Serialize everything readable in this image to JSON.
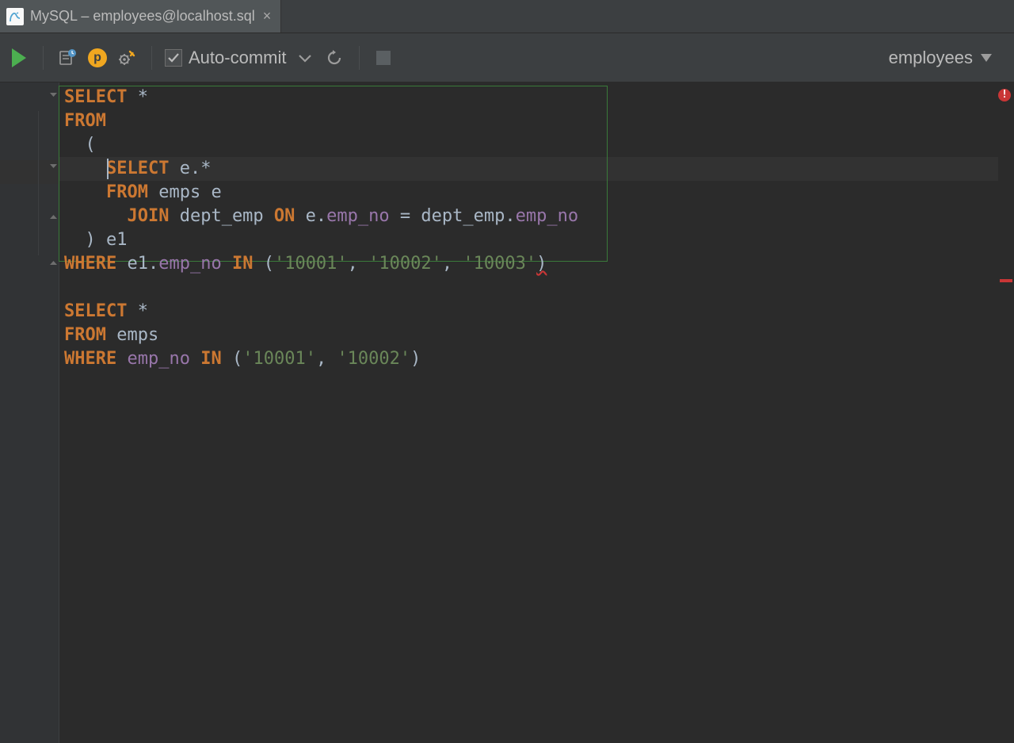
{
  "tab": {
    "title": "MySQL – employees@localhost.sql",
    "close_glyph": "×"
  },
  "toolbar": {
    "p_badge": "p",
    "autocommit_label": "Auto-commit",
    "schema_label": "employees"
  },
  "code": {
    "l1_select": "SELECT",
    "l1_star": " *",
    "l2_from": "FROM",
    "l3_lparen": "  (",
    "l4_indent": "    ",
    "l4_select": "SELECT",
    "l4_after": " e.",
    "l4_star": "*",
    "l5_indent": "    ",
    "l5_from": "FROM",
    "l5_after": " emps e",
    "l6_indent": "      ",
    "l6_join": "JOIN",
    "l6_a": " dept_emp ",
    "l6_on": "ON",
    "l6_b": " e.",
    "l6_emp1": "emp_no",
    "l6_c": " = dept_emp.",
    "l6_emp2": "emp_no",
    "l7_close": "  ) e1",
    "l8_where": "WHERE",
    "l8_a": " e1.",
    "l8_emp": "emp_no",
    "l8_sp1": " ",
    "l8_in": "IN",
    "l8_b": " (",
    "l8_s1": "'10001'",
    "l8_c1": ", ",
    "l8_s2": "'10002'",
    "l8_c2": ", ",
    "l8_s3": "'10003'",
    "l8_c3": ")",
    "l10_select": "SELECT",
    "l10_star": " *",
    "l11_from": "FROM",
    "l11_emps": " emps",
    "l12_where": "WHERE",
    "l12_sp": " ",
    "l12_emp": "emp_no",
    "l12_sp2": " ",
    "l12_in": "IN",
    "l12_b": " (",
    "l12_s1": "'10001'",
    "l12_c1": ", ",
    "l12_s2": "'10002'",
    "l12_c2": ")"
  }
}
